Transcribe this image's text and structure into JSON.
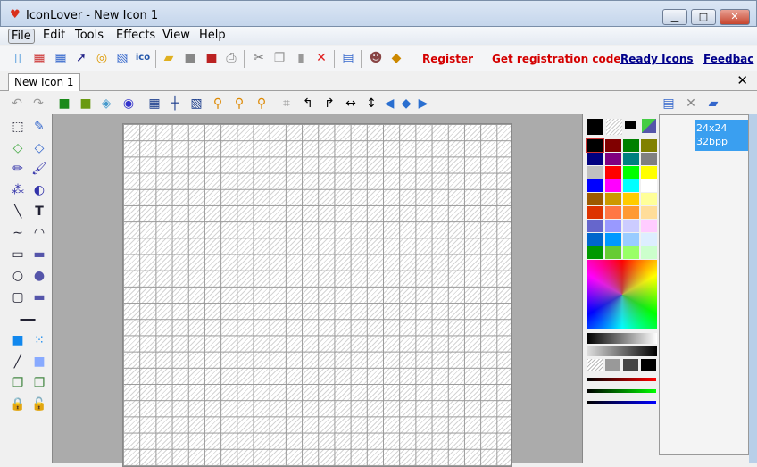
{
  "window": {
    "title": "IconLover - New Icon 1",
    "minimize": "▁",
    "maximize": "□",
    "close": "✕"
  },
  "menu": [
    "File",
    "Edit",
    "Tools",
    "Effects",
    "View",
    "Help"
  ],
  "toolbar": {
    "icons": [
      "new-icon",
      "new-library-icon",
      "new-image-icon",
      "new-cursor-icon",
      "new-animated-cursor-icon",
      "new-cursor-2-icon",
      "ico-icon",
      "open-icon",
      "save-icon",
      "save-all-icon",
      "print-icon",
      "cut-icon",
      "copy-icon",
      "paste-icon",
      "delete-icon",
      "properties-icon",
      "wizard-icon",
      "help-book-icon"
    ],
    "links": {
      "register": "Register",
      "get_code": "Get registration code",
      "ready_icons": "Ready Icons",
      "feedback": "Feedbac"
    }
  },
  "tabs": [
    {
      "label": "New Icon 1"
    }
  ],
  "colors": {
    "link_red": "#d40000",
    "link_blue": "#00008b",
    "selection": "#3a9ff0",
    "canvas_bg": "#ababab"
  },
  "palette": {
    "swatches": [
      "#000000",
      "#800000",
      "#008000",
      "#808000",
      "#000080",
      "#800080",
      "#008080",
      "#808080",
      "#c0c0c0",
      "#ff0000",
      "#00ff00",
      "#ffff00",
      "#0000ff",
      "#ff00ff",
      "#00ffff",
      "#ffffff",
      "#9c5a00",
      "#cc9900",
      "#ffcc00",
      "#ffff99",
      "#dd3300",
      "#ff7744",
      "#ff9933",
      "#ffdd99",
      "#6666cc",
      "#9999ff",
      "#ccccff",
      "#ffccff",
      "#0066cc",
      "#0099ff",
      "#99ccff",
      "#ddeeff",
      "#009900",
      "#66cc33",
      "#99ff66",
      "#ccffcc"
    ]
  },
  "formats": [
    {
      "size": "24x24",
      "depth": "32bpp"
    }
  ],
  "glyphs": {
    "undo": "↶",
    "redo": "↷",
    "hflip": "↔",
    "vflip": "↕",
    "text": "T",
    "close": "✕"
  }
}
